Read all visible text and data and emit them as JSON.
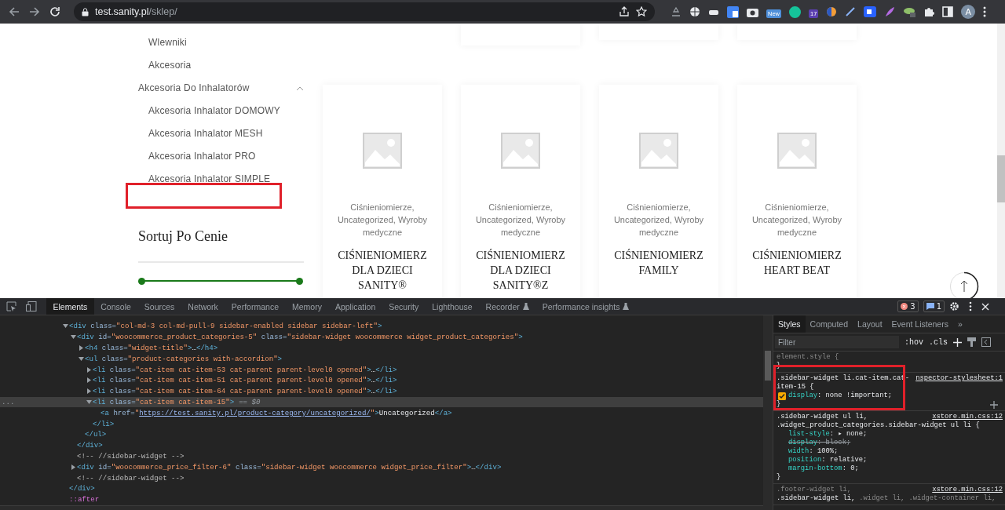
{
  "browser": {
    "url_host": "test.sanity.pl",
    "url_path": "/sklep/",
    "badges": [
      {
        "text": "New",
        "color": "#4f8fd9"
      },
      {
        "text": "17",
        "color": "#5b3fb0"
      }
    ],
    "avatar": "A"
  },
  "sidebar": {
    "above_items": [
      "Wlewniki",
      "Akcesoria"
    ],
    "categories": [
      {
        "label": "Akcesoria Do Inhalatorów",
        "expanded": true,
        "children": [
          {
            "label": "Akcesoria Inhalator DOMOWY"
          },
          {
            "label": "Akcesoria Inhalator MESH"
          },
          {
            "label": "Akcesoria Inhalator PRO"
          },
          {
            "label": "Akcesoria Inhalator SIMPLE"
          }
        ]
      }
    ],
    "sort_title": "Sortuj Po Cenie",
    "price_thumbs": [
      {
        "level": 0
      },
      {
        "level": 1
      }
    ]
  },
  "products": [
    {
      "categories": "Ciśnieniomierze, Uncategorized, Wyroby medyczne",
      "title": "CIŚNIENIOMIERZ DLA DZIECI SANITY®"
    },
    {
      "categories": "Ciśnieniomierze, Uncategorized, Wyroby medyczne",
      "title": "CIŚNIENIOMIERZ DLA DZIECI SANITY®Z"
    },
    {
      "categories": "Ciśnieniomierze, Uncategorized, Wyroby medyczne",
      "title": "CIŚNIENIOMIERZ FAMILY"
    },
    {
      "categories": "Ciśnieniomierze, Uncategorized, Wyroby medyczne",
      "title": "CIŚNIENIOMIERZ HEART BEAT"
    }
  ],
  "devtools": {
    "tabs": [
      {
        "label": "Elements",
        "selected": true
      },
      {
        "label": "Console",
        "selected": false
      },
      {
        "label": "Sources",
        "selected": false
      },
      {
        "label": "Network",
        "selected": false
      },
      {
        "label": "Performance",
        "selected": false
      },
      {
        "label": "Memory",
        "selected": false
      },
      {
        "label": "Application",
        "selected": false
      },
      {
        "label": "Security",
        "selected": false
      },
      {
        "label": "Lighthouse",
        "selected": false
      },
      {
        "label": "Recorder",
        "selected": false,
        "experimental": true
      },
      {
        "label": "Performance insights",
        "selected": false,
        "experimental": true
      }
    ],
    "error_count": "3",
    "message_count": "1",
    "elements": {
      "selection_marker": "...",
      "tree": [
        {
          "kind": "element",
          "open": "<div class=\"col-md-3 col-md-pull-9 sidebar-enabled sidebar sidebar-left\">",
          "close": "</div>",
          "expanded": true,
          "selected": false,
          "children": [
            {
              "kind": "element",
              "open": "<div id=\"woocommerce_product_categories-5\" class=\"sidebar-widget woocommerce widget_product_categories\">",
              "close": "</div>",
              "expanded": true,
              "selected": false,
              "children": [
                {
                  "kind": "element",
                  "open": "<h4 class=\"widget-title\">…",
                  "close": "</h4>",
                  "expanded": false,
                  "selected": false
                },
                {
                  "kind": "element",
                  "open": "<ul class=\"product-categories with-accordion\">",
                  "close": "</ul>",
                  "expanded": true,
                  "selected": false,
                  "children": [
                    {
                      "kind": "element",
                      "open": "<li class=\"cat-item cat-item-53 cat-parent parent-level0 opened\">…",
                      "close": "</li>",
                      "expanded": false,
                      "selected": false
                    },
                    {
                      "kind": "element",
                      "open": "<li class=\"cat-item cat-item-51 cat-parent parent-level0 opened\">…",
                      "close": "</li>",
                      "expanded": false,
                      "selected": false
                    },
                    {
                      "kind": "element",
                      "open": "<li class=\"cat-item cat-item-64 cat-parent parent-level0 opened\">…",
                      "close": "</li>",
                      "expanded": false,
                      "selected": false
                    },
                    {
                      "kind": "element",
                      "open": "<li class=\"cat-item cat-item-15\">",
                      "note": "== $0",
                      "close": "</li>",
                      "expanded": true,
                      "selected": true,
                      "children": [
                        {
                          "kind": "link-element",
                          "open": "<a href=\"",
                          "url": "https://test.sanity.pl/product-category/uncategorized/",
                          "rest": "\">Uncategorized</a>"
                        }
                      ]
                    }
                  ]
                }
              ]
            },
            {
              "kind": "comment",
              "open": "<!-- //sidebar-widget -->"
            },
            {
              "kind": "element",
              "open": "<div id=\"woocommerce_price_filter-6\" class=\"sidebar-widget woocommerce widget_price_filter\">…",
              "close": "</div>",
              "expanded": false,
              "selected": false
            },
            {
              "kind": "comment",
              "open": "<!-- //sidebar-widget -->"
            }
          ]
        },
        {
          "kind": "pseudo",
          "open": "::after"
        }
      ]
    },
    "styles": {
      "tabs": [
        {
          "label": "Styles",
          "selected": true
        },
        {
          "label": "Computed",
          "selected": false
        },
        {
          "label": "Layout",
          "selected": false
        },
        {
          "label": "Event Listeners",
          "selected": false
        },
        {
          "label": "»",
          "selected": false
        }
      ],
      "filter_placeholder": "Filter",
      "hov": ":hov",
      "cls": ".cls",
      "rules": [
        {
          "selectors": [
            {
              "text": "element.style {",
              "matched": false
            }
          ],
          "close": "}"
        },
        {
          "selectors": [
            {
              "text": ".sidebar-widget li.cat-item.cat-item-15 {",
              "matched": true
            }
          ],
          "source": "nspector-stylesheet:1",
          "close": "}",
          "add": true,
          "decls": [
            {
              "name": "display",
              "rest": ": none !important;",
              "checked": true,
              "overridden": false
            }
          ]
        },
        {
          "selectors": [
            {
              "text": ".sidebar-widget ul li,",
              "matched": true
            },
            {
              "text": ".widget_product_categories.sidebar-widget ul li {",
              "matched": true
            }
          ],
          "source": "xstore.min.css:12",
          "close": "}",
          "decls": [
            {
              "name": "list-style",
              "rest": ": ▸ none;",
              "checked": false,
              "overridden": false
            },
            {
              "name": "display",
              "rest": ": block;",
              "checked": false,
              "overridden": true
            },
            {
              "name": "width",
              "rest": ": 100%;",
              "checked": false,
              "overridden": false
            },
            {
              "name": "position",
              "rest": ": relative;",
              "checked": false,
              "overridden": false
            },
            {
              "name": "margin-bottom",
              "rest": ": 0;",
              "checked": false,
              "overridden": false
            }
          ]
        },
        {
          "selectors": [
            {
              "text": ".footer-widget li,",
              "matched": false
            },
            {
              "text": ".sidebar-widget li,",
              "matched": true
            },
            {
              "text": ".widget li,",
              "matched": false
            },
            {
              "text": ".widget-container li,",
              "matched": false
            }
          ],
          "source": "xstore.min.css:12"
        }
      ]
    }
  }
}
